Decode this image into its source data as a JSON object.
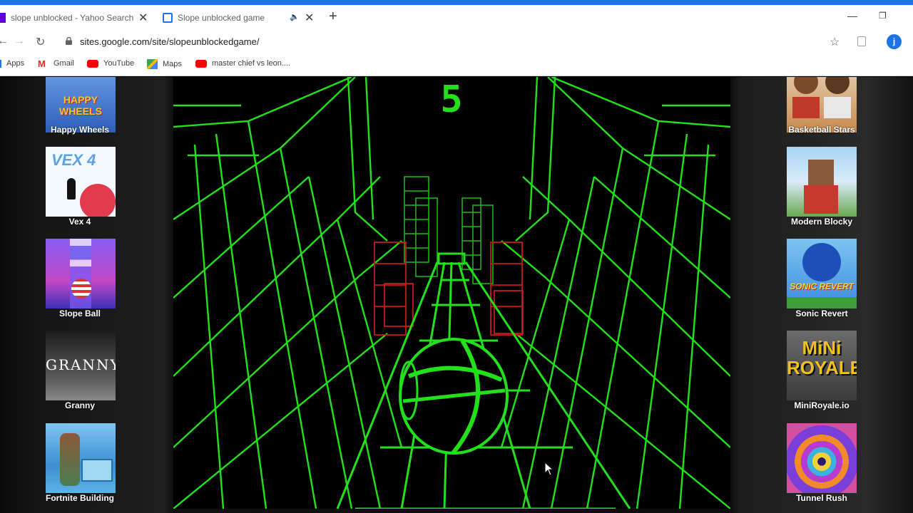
{
  "browser": {
    "tabs": [
      {
        "title": "slope unblocked - Yahoo Search",
        "active": false
      },
      {
        "title": "Slope unblocked game",
        "active": true
      }
    ],
    "new_tab_symbol": "+",
    "url": "sites.google.com/site/slopeunblockedgame/",
    "profile_initial": "j",
    "bookmarks": [
      {
        "label": "Apps",
        "icon": "apps-grid-icon"
      },
      {
        "label": "Gmail",
        "icon": "gmail-icon"
      },
      {
        "label": "YouTube",
        "icon": "youtube-icon"
      },
      {
        "label": "Maps",
        "icon": "maps-icon"
      },
      {
        "label": "master chief vs leon....",
        "icon": "youtube-icon"
      }
    ]
  },
  "sidebar_left": [
    {
      "name": "Happy Wheels",
      "thumb_text": "HAPPY WHEELS",
      "colors": [
        "#4a7fd4",
        "#f3c33a"
      ]
    },
    {
      "name": "Vex 4",
      "thumb_text": "VEX 4",
      "colors": [
        "#e9f2ff",
        "#e23b4e"
      ]
    },
    {
      "name": "Slope Ball",
      "thumb_text": "",
      "colors": [
        "#7a3fd9",
        "#e84f9c"
      ]
    },
    {
      "name": "Granny",
      "thumb_text": "GRANNY",
      "colors": [
        "#2b2b2b",
        "#8c8c8c"
      ]
    },
    {
      "name": "Fortnite Building",
      "thumb_text": "",
      "colors": [
        "#4aa3e8",
        "#2b6c9c"
      ]
    }
  ],
  "sidebar_right": [
    {
      "name": "Basketball Stars",
      "thumb_text": "",
      "colors": [
        "#c77b3a",
        "#f0e0c8"
      ]
    },
    {
      "name": "Modern Blocky",
      "thumb_text": "",
      "colors": [
        "#6aa84f",
        "#c7392f"
      ]
    },
    {
      "name": "Sonic Revert",
      "thumb_text": "SONIC REVERT",
      "colors": [
        "#2f6de0",
        "#f6d531"
      ]
    },
    {
      "name": "MiniRoyale.io",
      "thumb_text": "MiNi ROYALE",
      "colors": [
        "#f1c21b",
        "#3b3b3b"
      ]
    },
    {
      "name": "Tunnel Rush",
      "thumb_text": "",
      "colors": [
        "#b53cd0",
        "#f0d13a"
      ]
    }
  ],
  "game": {
    "score": "5",
    "grid_color": "#22e01a",
    "obstacle_color": "#c41a1a"
  }
}
